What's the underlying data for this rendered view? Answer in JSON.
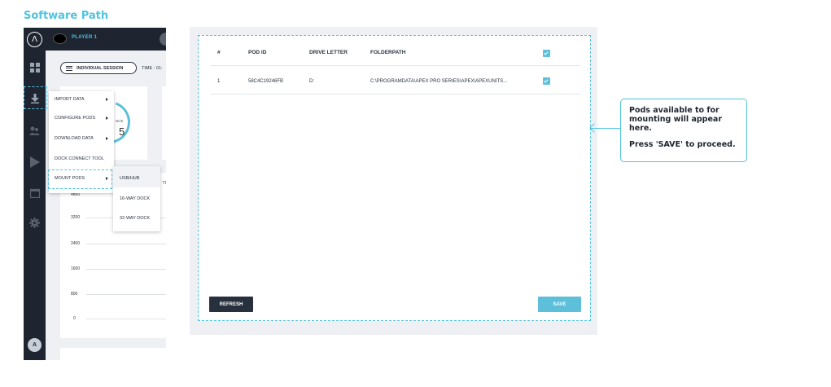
{
  "page": {
    "title": "Software Path"
  },
  "app": {
    "player_name": "PLAYER 1",
    "session_label": "INDIVIDUAL SESSION",
    "time_label": "TIME : 01:",
    "gauge_partial": "NCE",
    "gauge_digit": "5",
    "chart_ticks": [
      "4800",
      "3200",
      "2400",
      "1600",
      "800",
      "0"
    ],
    "chart_col_partial": "TI",
    "avatar_initial": "A",
    "menu": {
      "items": [
        {
          "label": "IMPORT DATA",
          "has_submenu": true
        },
        {
          "label": "CONFIGURE PODS",
          "has_submenu": true
        },
        {
          "label": "DOWNLOAD DATA",
          "has_submenu": true
        },
        {
          "label": "DOCK CONNECT TOOL",
          "has_submenu": false
        },
        {
          "label": "MOUNT PODS",
          "has_submenu": true
        }
      ],
      "submenu": [
        "USB/HUB",
        "16-WAY DOCK",
        "32-WAY DOCK"
      ]
    },
    "rail_icons": [
      "logo-icon",
      "dashboard-icon",
      "download-icon",
      "users-icon",
      "play-icon",
      "calendar-icon",
      "settings-icon"
    ]
  },
  "dialog": {
    "columns": [
      "#",
      "POD ID",
      "DRIVE LETTER",
      "FOLDERPATH"
    ],
    "header_checked": true,
    "rows": [
      {
        "num": "1",
        "pod_id": "58C4C19246FB",
        "drive": "D:",
        "folderpath": "C:\\PROGRAMDATA\\APEX PRO SERIES\\APEX\\APEXUNITS...",
        "checked": true
      }
    ],
    "refresh_label": "REFRESH",
    "save_label": "SAVE"
  },
  "callout": {
    "line1": "Pods available to for mounting will appear here.",
    "line2_prefix": "Press ",
    "line2_bold": "'SAVE'",
    "line2_suffix": " to proceed."
  },
  "colors": {
    "accent": "#4fc3e0",
    "dark": "#1e2530",
    "save": "#5dbfd9"
  }
}
